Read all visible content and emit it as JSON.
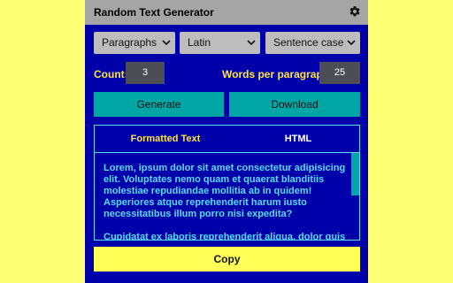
{
  "app": {
    "title": "Random Text Generator"
  },
  "toolbar": {
    "type_select": "Paragraphs",
    "language_select": "Latin",
    "case_select": "Sentence case",
    "count_label": "Count:",
    "count_value": "3",
    "words_label": "Words per paragraph:",
    "words_value": "25",
    "generate_label": "Generate",
    "download_label": "Download"
  },
  "tabs": {
    "formatted": "Formatted Text",
    "html": "HTML"
  },
  "output": {
    "paragraphs": [
      "Lorem, ipsum dolor sit amet consectetur adipisicing elit. Voluptates nemo quam et quaerat blanditiis molestiae repudiandae mollitia ab in quidem! Asperiores atque reprehenderit harum iusto necessitatibus illum porro nisi expedita?",
      "Cupidatat ex laboris reprehenderit aliqua, dolor quis"
    ]
  },
  "copy_label": "Copy",
  "colors": {
    "page_background": "#fcff74",
    "app_background": "#0000aa",
    "accent": "#00a6a6",
    "label_yellow": "#ffe53a",
    "text_cyan": "#55dcff"
  },
  "icons": {
    "settings": "gear-icon",
    "dropdown": "chevron-down-icon"
  }
}
